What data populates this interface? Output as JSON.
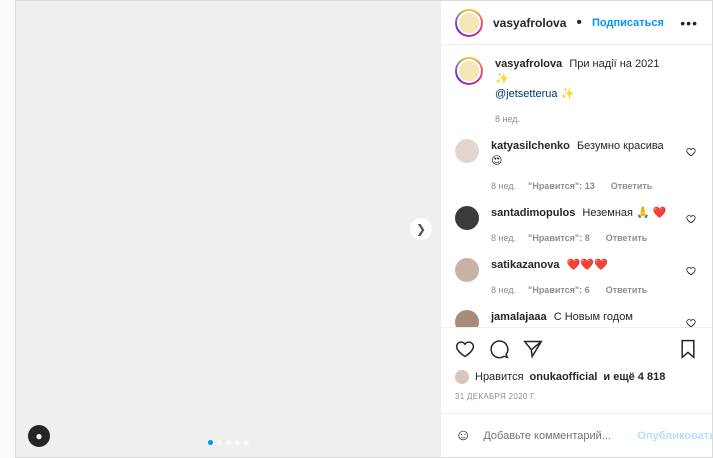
{
  "post": {
    "media_placeholder": "",
    "carousel_count": 5,
    "carousel_active": 0,
    "author": "vasyafrolova",
    "follow_label": "Подписаться",
    "more_label": "•••",
    "caption_text": "При надії на 2021 ✨",
    "caption_mention": "@jetsetterua ✨",
    "caption_time": "8 нед."
  },
  "comments": [
    {
      "user": "katyasilchenko",
      "text": "Безумно красива 😍",
      "time": "8 нед.",
      "likes": "\"Нравится\": 13",
      "reply": "Ответить"
    },
    {
      "user": "santadimopulos",
      "text": "Неземная 🙏 ❤️",
      "time": "8 нед.",
      "likes": "\"Нравится\": 8",
      "reply": "Ответить"
    },
    {
      "user": "satikazanova",
      "text": "❤️❤️❤️",
      "time": "8 нед.",
      "likes": "\"Нравится\": 6",
      "reply": "Ответить"
    },
    {
      "user": "jamalajaaa",
      "text": "С Новым годом",
      "time": "",
      "likes": "",
      "reply": ""
    }
  ],
  "footer": {
    "likes_prefix": "Нравится",
    "likes_user": "onukaofficial",
    "likes_suffix": "и ещё 4 818",
    "date": "31 ДЕКАБРЯ 2020 Г.",
    "comment_placeholder": "Добавьте комментарий...",
    "publish_label": "Опубликовать"
  }
}
